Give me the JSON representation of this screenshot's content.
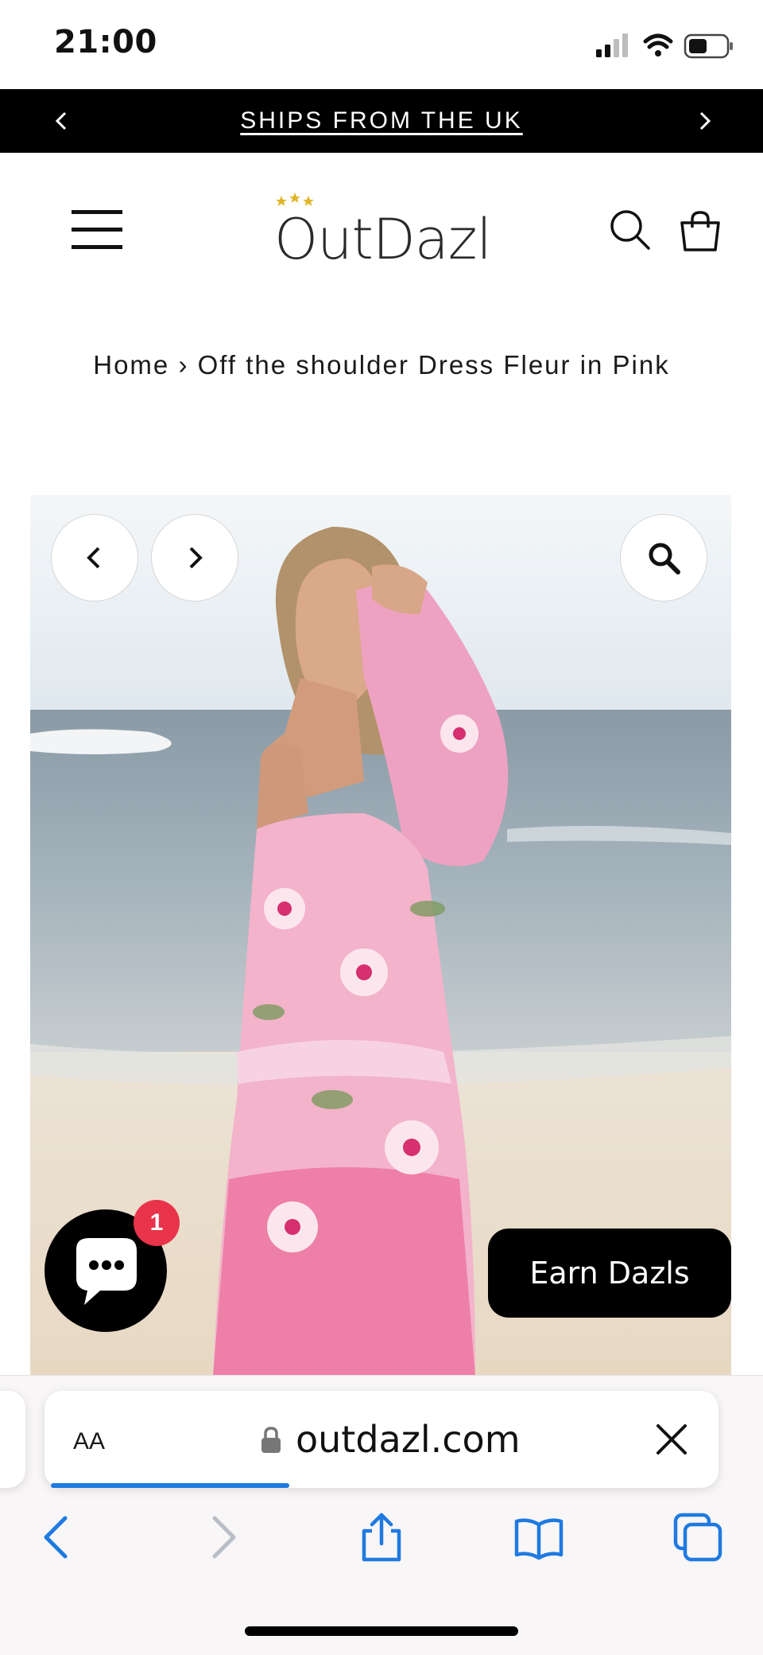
{
  "status_bar": {
    "time": "21:00"
  },
  "announcement": {
    "text": "SHIPS FROM THE UK"
  },
  "header": {
    "logo": "OutDazl"
  },
  "breadcrumb": {
    "home": "Home",
    "separator": "›",
    "current": "Off the shoulder Dress Fleur in Pink"
  },
  "widgets": {
    "chat_badge_count": "1",
    "earn_label": "Earn Dazls"
  },
  "browser": {
    "aa_label": "AA",
    "url": "outdazl.com",
    "load_progress": 0.3
  },
  "colors": {
    "accent_blue": "#1f7ae0",
    "badge_red": "#e8334a",
    "star_gold": "#e0b52a"
  }
}
